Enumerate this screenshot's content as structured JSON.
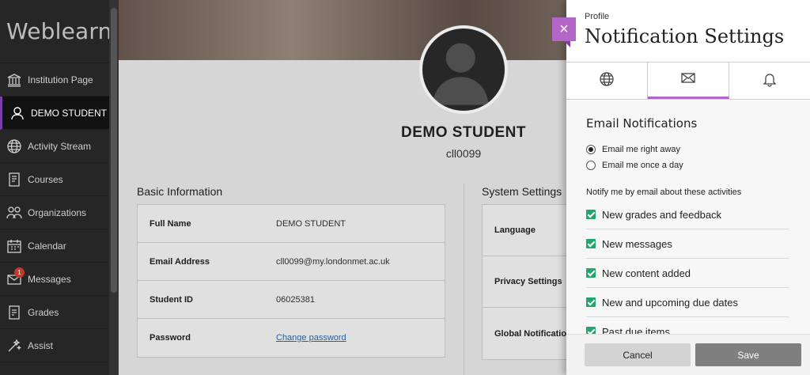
{
  "sidebar": {
    "brand": "Weblearn",
    "items": [
      {
        "label": "Institution Page",
        "icon": "institution-icon"
      },
      {
        "label": "DEMO STUDENT",
        "icon": "user-icon",
        "active": true
      },
      {
        "label": "Activity Stream",
        "icon": "globe-icon"
      },
      {
        "label": "Courses",
        "icon": "courses-icon"
      },
      {
        "label": "Organizations",
        "icon": "organizations-icon"
      },
      {
        "label": "Calendar",
        "icon": "calendar-icon"
      },
      {
        "label": "Messages",
        "icon": "mail-icon",
        "badge": "1"
      },
      {
        "label": "Grades",
        "icon": "grades-icon"
      },
      {
        "label": "Assist",
        "icon": "assist-icon"
      }
    ]
  },
  "profile": {
    "name": "DEMO STUDENT",
    "id": "cll0099",
    "basic_title": "Basic Information",
    "system_title": "System Settings",
    "basic_rows": [
      {
        "label": "Full Name",
        "value": "DEMO STUDENT"
      },
      {
        "label": "Email Address",
        "value": "cll0099@my.londonmet.ac.uk"
      },
      {
        "label": "Student ID",
        "value": "06025381"
      },
      {
        "label": "Password",
        "value": "Change password"
      }
    ],
    "system_rows": [
      "Language",
      "Privacy Settings",
      "Global Notificatio"
    ]
  },
  "panel": {
    "eyebrow": "Profile",
    "title": "Notification Settings",
    "close_glyph": "×",
    "tabs": [
      "globe-icon",
      "mail-icon",
      "bell-icon"
    ],
    "active_tab": 1,
    "heading": "Email Notifications",
    "radios": [
      {
        "label": "Email me right away",
        "checked": true
      },
      {
        "label": "Email me once a day",
        "checked": false
      }
    ],
    "notify_label": "Notify me by email about these activities",
    "checks": [
      "New grades and feedback",
      "New messages",
      "New content added",
      "New and upcoming due dates",
      "Past due items"
    ],
    "cancel": "Cancel",
    "save": "Save"
  },
  "colors": {
    "accent": "#b466c8",
    "check_green": "#24a56b",
    "sidebar_bg": "#262626"
  }
}
